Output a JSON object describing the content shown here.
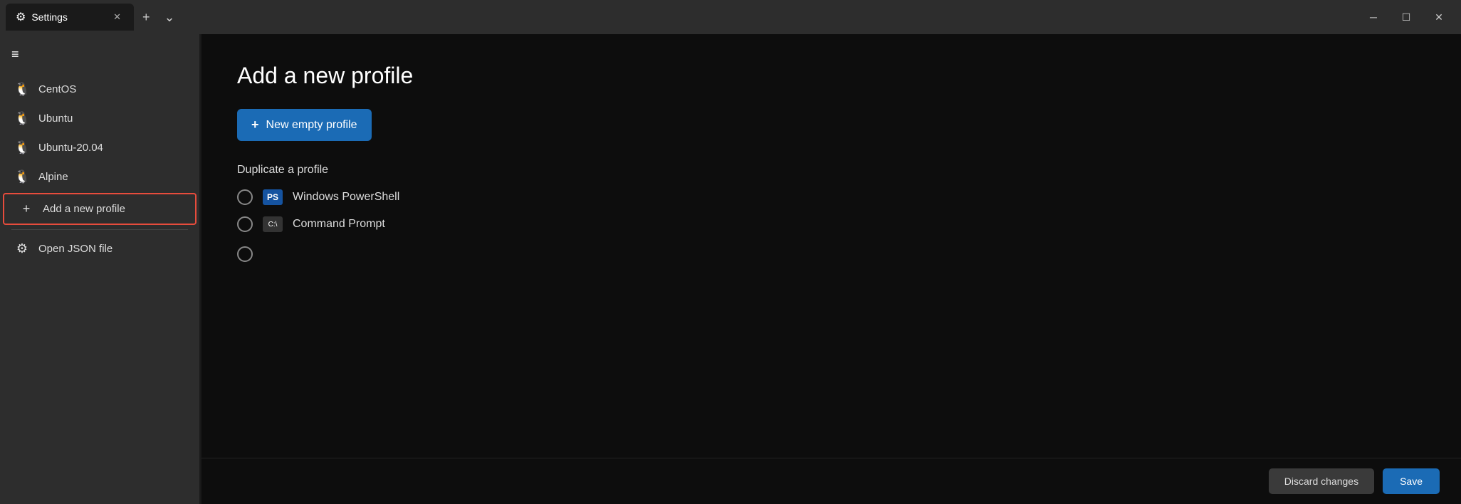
{
  "titleBar": {
    "tabLabel": "Settings",
    "gearIcon": "⚙",
    "tabCloseIcon": "✕",
    "newTabIcon": "+",
    "dropdownIcon": "⌄",
    "minimizeIcon": "─",
    "maximizeIcon": "☐",
    "closeIcon": "✕"
  },
  "sidebar": {
    "hamburgerIcon": "≡",
    "items": [
      {
        "id": "centos",
        "label": "CentOS",
        "icon": "🐧"
      },
      {
        "id": "ubuntu",
        "label": "Ubuntu",
        "icon": "🐧"
      },
      {
        "id": "ubuntu2004",
        "label": "Ubuntu-20.04",
        "icon": "🐧"
      },
      {
        "id": "alpine",
        "label": "Alpine",
        "icon": "🐧"
      },
      {
        "id": "add-profile",
        "label": "Add a new profile",
        "icon": "+",
        "highlighted": true
      }
    ],
    "bottomItems": [
      {
        "id": "open-json",
        "label": "Open JSON file",
        "icon": "⚙"
      }
    ]
  },
  "content": {
    "pageTitle": "Add a new profile",
    "newEmptyProfileBtn": "New empty profile",
    "newEmptyProfilePlusIcon": "+",
    "duplicateLabel": "Duplicate a profile",
    "profiles": [
      {
        "id": "powershell",
        "name": "Windows PowerShell",
        "iconType": "ps"
      },
      {
        "id": "cmd",
        "name": "Command Prompt",
        "iconType": "cmd"
      }
    ],
    "psIconLabel": "PS",
    "cmdIconLabel": "C:\\",
    "discardBtn": "Discard changes",
    "saveBtn": "Save"
  }
}
